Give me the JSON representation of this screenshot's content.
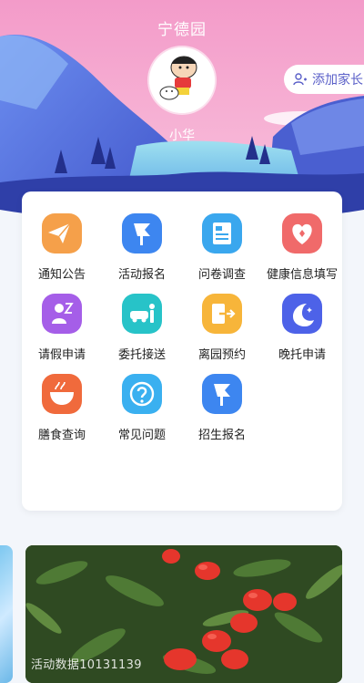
{
  "header": {
    "school_name": "宁德园",
    "child_name": "小华",
    "add_parent_label": "添加家长"
  },
  "menu": {
    "items": [
      {
        "label": "通知公告",
        "icon": "paper-plane-icon",
        "color": "#f5a04a"
      },
      {
        "label": "活动报名",
        "icon": "flag-icon",
        "color": "#3d86f0"
      },
      {
        "label": "问卷调查",
        "icon": "document-icon",
        "color": "#3aa7ee"
      },
      {
        "label": "健康信息填写",
        "icon": "heart-icon",
        "color": "#f06a6a"
      },
      {
        "label": "请假申请",
        "icon": "leave-person-icon",
        "color": "#a55ee8"
      },
      {
        "label": "委托接送",
        "icon": "car-pickup-icon",
        "color": "#27c3c8"
      },
      {
        "label": "离园预约",
        "icon": "exit-arrow-icon",
        "color": "#f7b53a"
      },
      {
        "label": "晚托申请",
        "icon": "moon-icon",
        "color": "#4d62e8"
      },
      {
        "label": "膳食查询",
        "icon": "bowl-icon",
        "color": "#f06a3c"
      },
      {
        "label": "常见问题",
        "icon": "question-icon",
        "color": "#3ab0f0"
      },
      {
        "label": "招生报名",
        "icon": "flag-icon",
        "color": "#3d86f0"
      }
    ]
  },
  "banner": {
    "caption": "活动数据10131139"
  },
  "colors": {
    "hero_sky_top": "#f58fc4",
    "hero_mountain": "#5a6fd8",
    "accent": "#5a5fc8"
  }
}
